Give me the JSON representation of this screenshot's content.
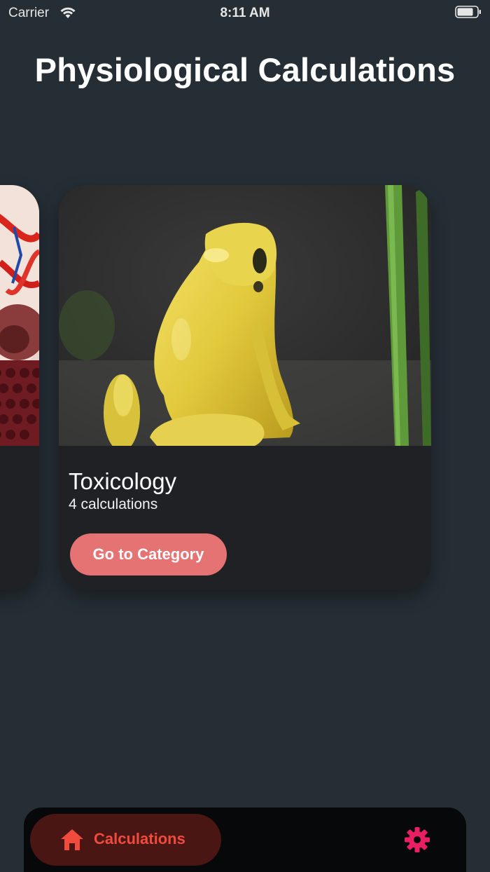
{
  "status_bar": {
    "carrier": "Carrier",
    "time": "8:11 AM",
    "wifi_icon": "wifi-icon",
    "battery_icon": "battery-icon"
  },
  "header": {
    "title": "Physiological Calculations"
  },
  "carousel": {
    "cards": [
      {
        "image": "anatomy-heart-model-image",
        "partially_visible": true
      },
      {
        "title": "Toxicology",
        "subtitle": "4 calculations",
        "button_label": "Go to Category",
        "image": "yellow-poison-frog-image"
      }
    ]
  },
  "bottom_nav": {
    "items": [
      {
        "label": "Calculations",
        "icon": "home-icon",
        "active": true
      },
      {
        "icon": "gear-icon",
        "active": false
      }
    ]
  },
  "colors": {
    "background": "#252e35",
    "card_background": "#202124",
    "button": "#e57373",
    "nav_background": "#06080a",
    "nav_active_pill": "#4a1614",
    "nav_active_text": "#f04b3c",
    "gear_icon": "#e91e63"
  }
}
